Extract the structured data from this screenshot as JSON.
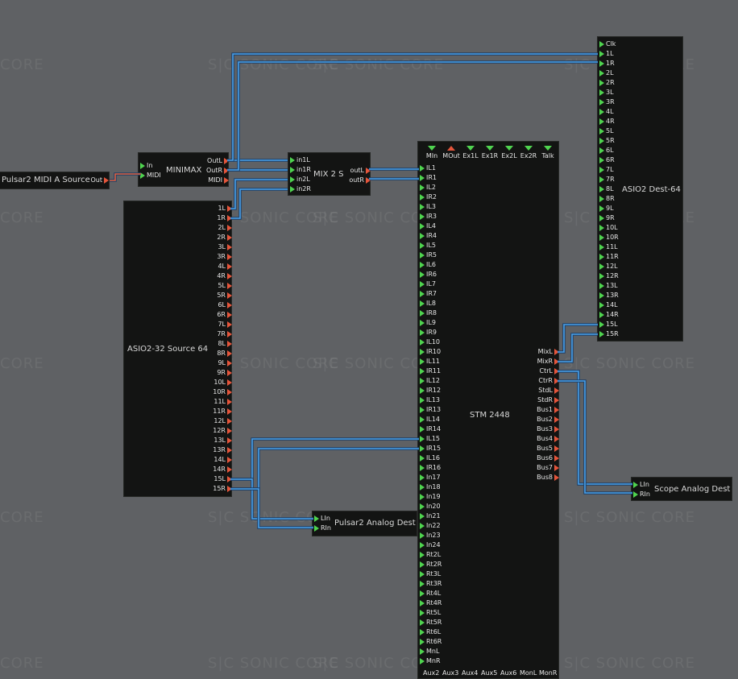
{
  "watermark": {
    "logo": "S|C",
    "text": "SONIC CORE",
    "core": "CORE"
  },
  "colors": {
    "background": "#5f6164",
    "module": "#131413",
    "in_port": "#4fd34f",
    "out_port": "#e4553b",
    "wire_audio": "#4aa0e8",
    "wire_midi": "#e06040"
  },
  "modules": {
    "midi_source": {
      "title": "Pulsar2 MIDI A Source",
      "outputs": [
        "Out"
      ]
    },
    "minimax": {
      "title": "MINIMAX",
      "inputs": [
        "In",
        "MIDI"
      ],
      "outputs": [
        "OutL",
        "OutR",
        "MIDI"
      ]
    },
    "mix2s": {
      "title": "MIX 2 S",
      "inputs": [
        "in1L",
        "in1R",
        "in2L",
        "in2R"
      ],
      "outputs": [
        "outL",
        "outR"
      ]
    },
    "asio_src": {
      "title": "ASIO2-32 Source 64",
      "outputs": [
        "1L",
        "1R",
        "2L",
        "2R",
        "3L",
        "3R",
        "4L",
        "4R",
        "5L",
        "5R",
        "6L",
        "6R",
        "7L",
        "7R",
        "8L",
        "8R",
        "9L",
        "9R",
        "10L",
        "10R",
        "11L",
        "11R",
        "12L",
        "12R",
        "13L",
        "13R",
        "14L",
        "14R",
        "15L",
        "15R"
      ]
    },
    "stm": {
      "title": "STM 2448",
      "top_ports": [
        {
          "label": "MIn",
          "type": "in"
        },
        {
          "label": "MOut",
          "type": "out"
        },
        {
          "label": "Ex1L",
          "type": "in"
        },
        {
          "label": "Ex1R",
          "type": "in"
        },
        {
          "label": "Ex2L",
          "type": "in"
        },
        {
          "label": "Ex2R",
          "type": "in"
        },
        {
          "label": "Talk",
          "type": "in"
        }
      ],
      "inputs": [
        "IL1",
        "IR1",
        "IL2",
        "IR2",
        "IL3",
        "IR3",
        "IL4",
        "IR4",
        "IL5",
        "IR5",
        "IL6",
        "IR6",
        "IL7",
        "IR7",
        "IL8",
        "IR8",
        "IL9",
        "IR9",
        "IL10",
        "IR10",
        "IL11",
        "IR11",
        "IL12",
        "IR12",
        "IL13",
        "IR13",
        "IL14",
        "IR14",
        "IL15",
        "IR15",
        "IL16",
        "IR16",
        "In17",
        "In18",
        "In19",
        "In20",
        "In21",
        "In22",
        "In23",
        "In24",
        "Rt2L",
        "Rt2R",
        "Rt3L",
        "Rt3R",
        "Rt4L",
        "Rt4R",
        "Rt5L",
        "Rt5R",
        "Rt6L",
        "Rt6R",
        "MnL",
        "MnR"
      ],
      "outputs": [
        "MixL",
        "MixR",
        "CtrL",
        "CtrR",
        "StdL",
        "StdR",
        "Bus1",
        "Bus2",
        "Bus3",
        "Bus4",
        "Bus5",
        "Bus6",
        "Bus7",
        "Bus8"
      ],
      "bottom_labels": [
        "Aux2",
        "Aux3",
        "Aux4",
        "Aux5",
        "Aux6",
        "MonL",
        "MonR"
      ]
    },
    "asio_dest": {
      "title": "ASIO2 Dest-64",
      "inputs": [
        "Clk",
        "1L",
        "1R",
        "2L",
        "2R",
        "3L",
        "3R",
        "4L",
        "4R",
        "5L",
        "5R",
        "6L",
        "6R",
        "7L",
        "7R",
        "8L",
        "8R",
        "9L",
        "9R",
        "10L",
        "10R",
        "11L",
        "11R",
        "12L",
        "12R",
        "13L",
        "13R",
        "14L",
        "14R",
        "15L",
        "15R"
      ]
    },
    "pulsar_dest": {
      "title": "Pulsar2 Analog Dest",
      "inputs": [
        "LIn",
        "RIn"
      ]
    },
    "scope_dest": {
      "title": "Scope Analog Dest",
      "inputs": [
        "LIn",
        "RIn"
      ]
    }
  }
}
